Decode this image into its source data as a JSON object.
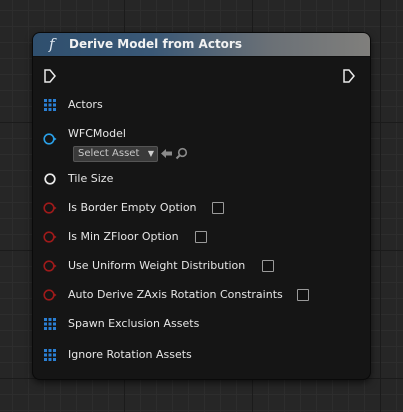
{
  "node": {
    "title": "Derive Model from Actors",
    "function_icon": "f"
  },
  "pins": {
    "actors": "Actors",
    "wfc_model": "WFCModel",
    "tile_size": "Tile Size",
    "is_border_empty": "Is Border Empty Option",
    "is_min_zfloor": "Is Min ZFloor Option",
    "use_uniform_weight": "Use Uniform Weight Distribution",
    "auto_derive_zaxis": "Auto Derive ZAxis Rotation Constraints",
    "spawn_exclusion": "Spawn Exclusion Assets",
    "ignore_rotation": "Ignore Rotation Assets"
  },
  "asset_picker": {
    "selected": "Select Asset"
  },
  "colors": {
    "object_pin": "#2aa0e8",
    "array_pin": "#2a7fd4",
    "bool_pin": "#9e1a1a",
    "struct_pin": "#eaeaea",
    "exec_pin": "#eaeaea"
  },
  "icons": {
    "exec_in": "exec-in-icon",
    "exec_out": "exec-out-icon",
    "browse": "use-selected-arrow-icon",
    "find": "search-icon"
  }
}
